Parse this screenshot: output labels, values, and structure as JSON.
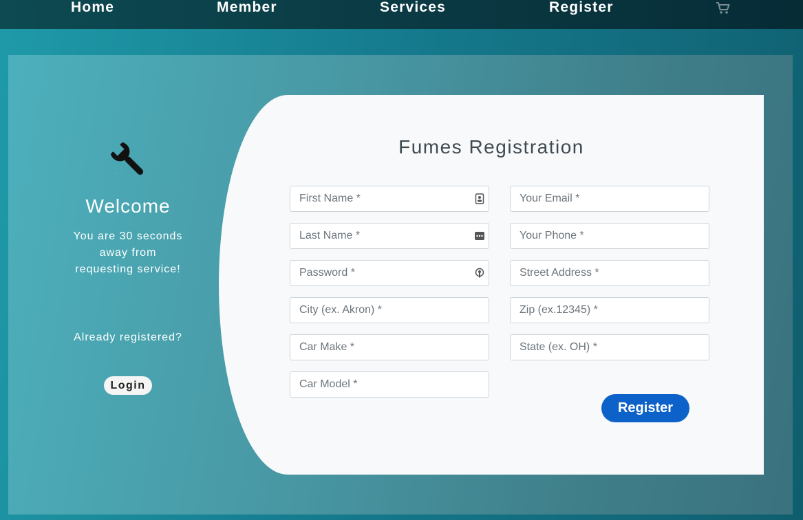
{
  "nav": {
    "items": [
      {
        "label": "Home"
      },
      {
        "label": "Member"
      },
      {
        "label": "Services"
      },
      {
        "label": "Register"
      }
    ],
    "cart_icon": "shopping-cart-icon"
  },
  "welcome": {
    "icon": "wrench-icon",
    "title": "Welcome",
    "subtitle_lines": [
      "You are 30 seconds",
      "away from",
      "requesting service!"
    ],
    "already_registered": "Already registered?",
    "login_label": "Login"
  },
  "form": {
    "title": "Fumes Registration",
    "fields": {
      "first_name": {
        "placeholder": "First Name *",
        "value": ""
      },
      "email": {
        "placeholder": "Your Email *",
        "value": ""
      },
      "last_name": {
        "placeholder": "Last Name *",
        "value": ""
      },
      "phone": {
        "placeholder": "Your Phone *",
        "value": ""
      },
      "password": {
        "placeholder": "Password *",
        "value": ""
      },
      "street": {
        "placeholder": "Street Address *",
        "value": ""
      },
      "city": {
        "placeholder": "City (ex. Akron) *",
        "value": ""
      },
      "zip": {
        "placeholder": "Zip (ex.12345) *",
        "value": ""
      },
      "car_make": {
        "placeholder": "Car Make *",
        "value": ""
      },
      "state": {
        "placeholder": "State (ex. OH) *",
        "value": ""
      },
      "car_model": {
        "placeholder": "Car Model *",
        "value": ""
      }
    },
    "register_label": "Register"
  },
  "colors": {
    "accent": "#0d62c9",
    "nav_bg": "#0b3a44",
    "panel_bg": "#4898a4",
    "card_bg": "#f8f9fa"
  }
}
